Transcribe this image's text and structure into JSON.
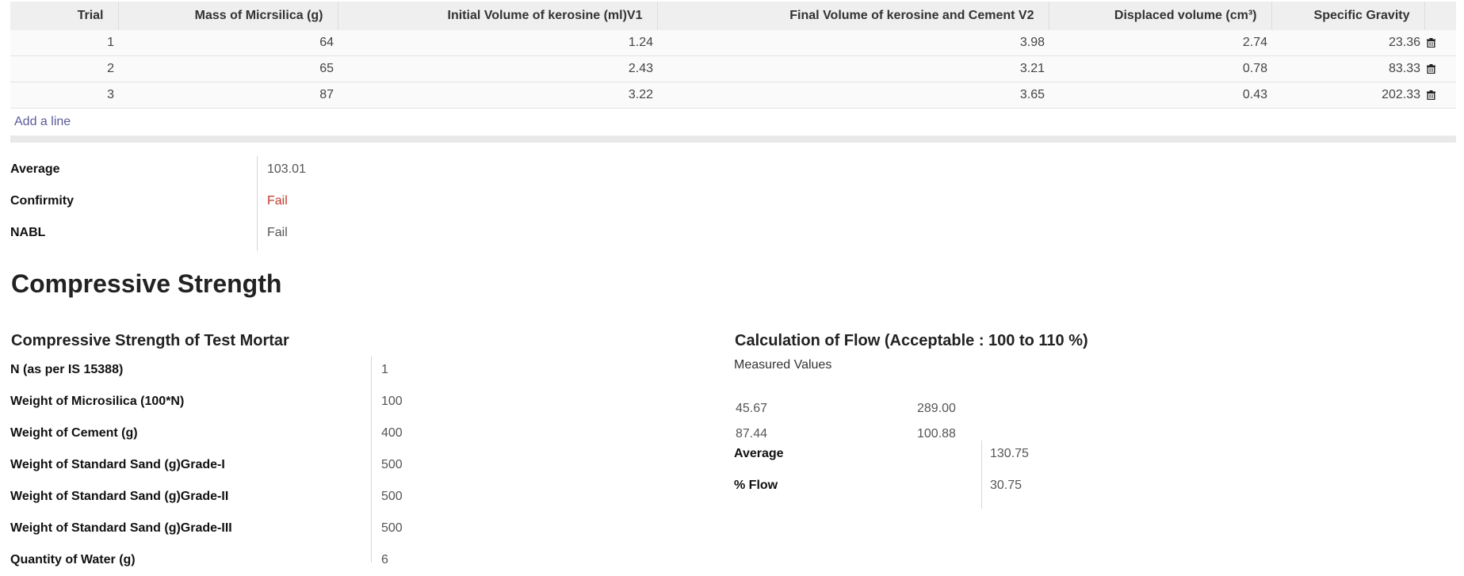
{
  "trials": {
    "headers": {
      "trial": "Trial",
      "mass": "Mass of Micrsilica (g)",
      "initial": "Initial Volume of kerosine (ml)V1",
      "final": "Final Volume of kerosine and Cement V2",
      "displaced": "Displaced volume (cm³)",
      "sg": "Specific Gravity"
    },
    "rows": [
      {
        "trial": "1",
        "mass": "64",
        "initial": "1.24",
        "final": "3.98",
        "displaced": "2.74",
        "sg": "23.36"
      },
      {
        "trial": "2",
        "mass": "65",
        "initial": "2.43",
        "final": "3.21",
        "displaced": "0.78",
        "sg": "83.33"
      },
      {
        "trial": "3",
        "mass": "87",
        "initial": "3.22",
        "final": "3.65",
        "displaced": "0.43",
        "sg": "202.33"
      }
    ],
    "add_line": "Add a line",
    "delete_icon": "trash-icon"
  },
  "summary": {
    "average_label": "Average",
    "average_value": "103.01",
    "confirmity_label": "Confirmity",
    "confirmity_value": "Fail",
    "nabl_label": "NABL",
    "nabl_value": "Fail",
    "fail_color": "#c0392b"
  },
  "compressive": {
    "title": "Compressive Strength",
    "mortar_title": "Compressive Strength of Test Mortar",
    "fields": [
      {
        "label": "N (as per IS 15388)",
        "value": "1"
      },
      {
        "label": "Weight of Microsilica (100*N)",
        "value": "100"
      },
      {
        "label": "Weight of Cement (g)",
        "value": "400"
      },
      {
        "label": "Weight of Standard Sand (g)Grade-I",
        "value": "500"
      },
      {
        "label": "Weight of Standard Sand (g)Grade-II",
        "value": "500"
      },
      {
        "label": "Weight of Standard Sand (g)Grade-III",
        "value": "500"
      },
      {
        "label": "Quantity of Water (g)",
        "value": "6"
      }
    ]
  },
  "flow": {
    "title": "Calculation of Flow (Acceptable : 100 to 110 %)",
    "measured_title": "Measured Values",
    "measured": [
      {
        "a": "45.67",
        "b": "289.00"
      },
      {
        "a": "87.44",
        "b": "100.88"
      }
    ],
    "average_label": "Average",
    "average_value": "130.75",
    "flow_label": "% Flow",
    "flow_value": "30.75"
  }
}
